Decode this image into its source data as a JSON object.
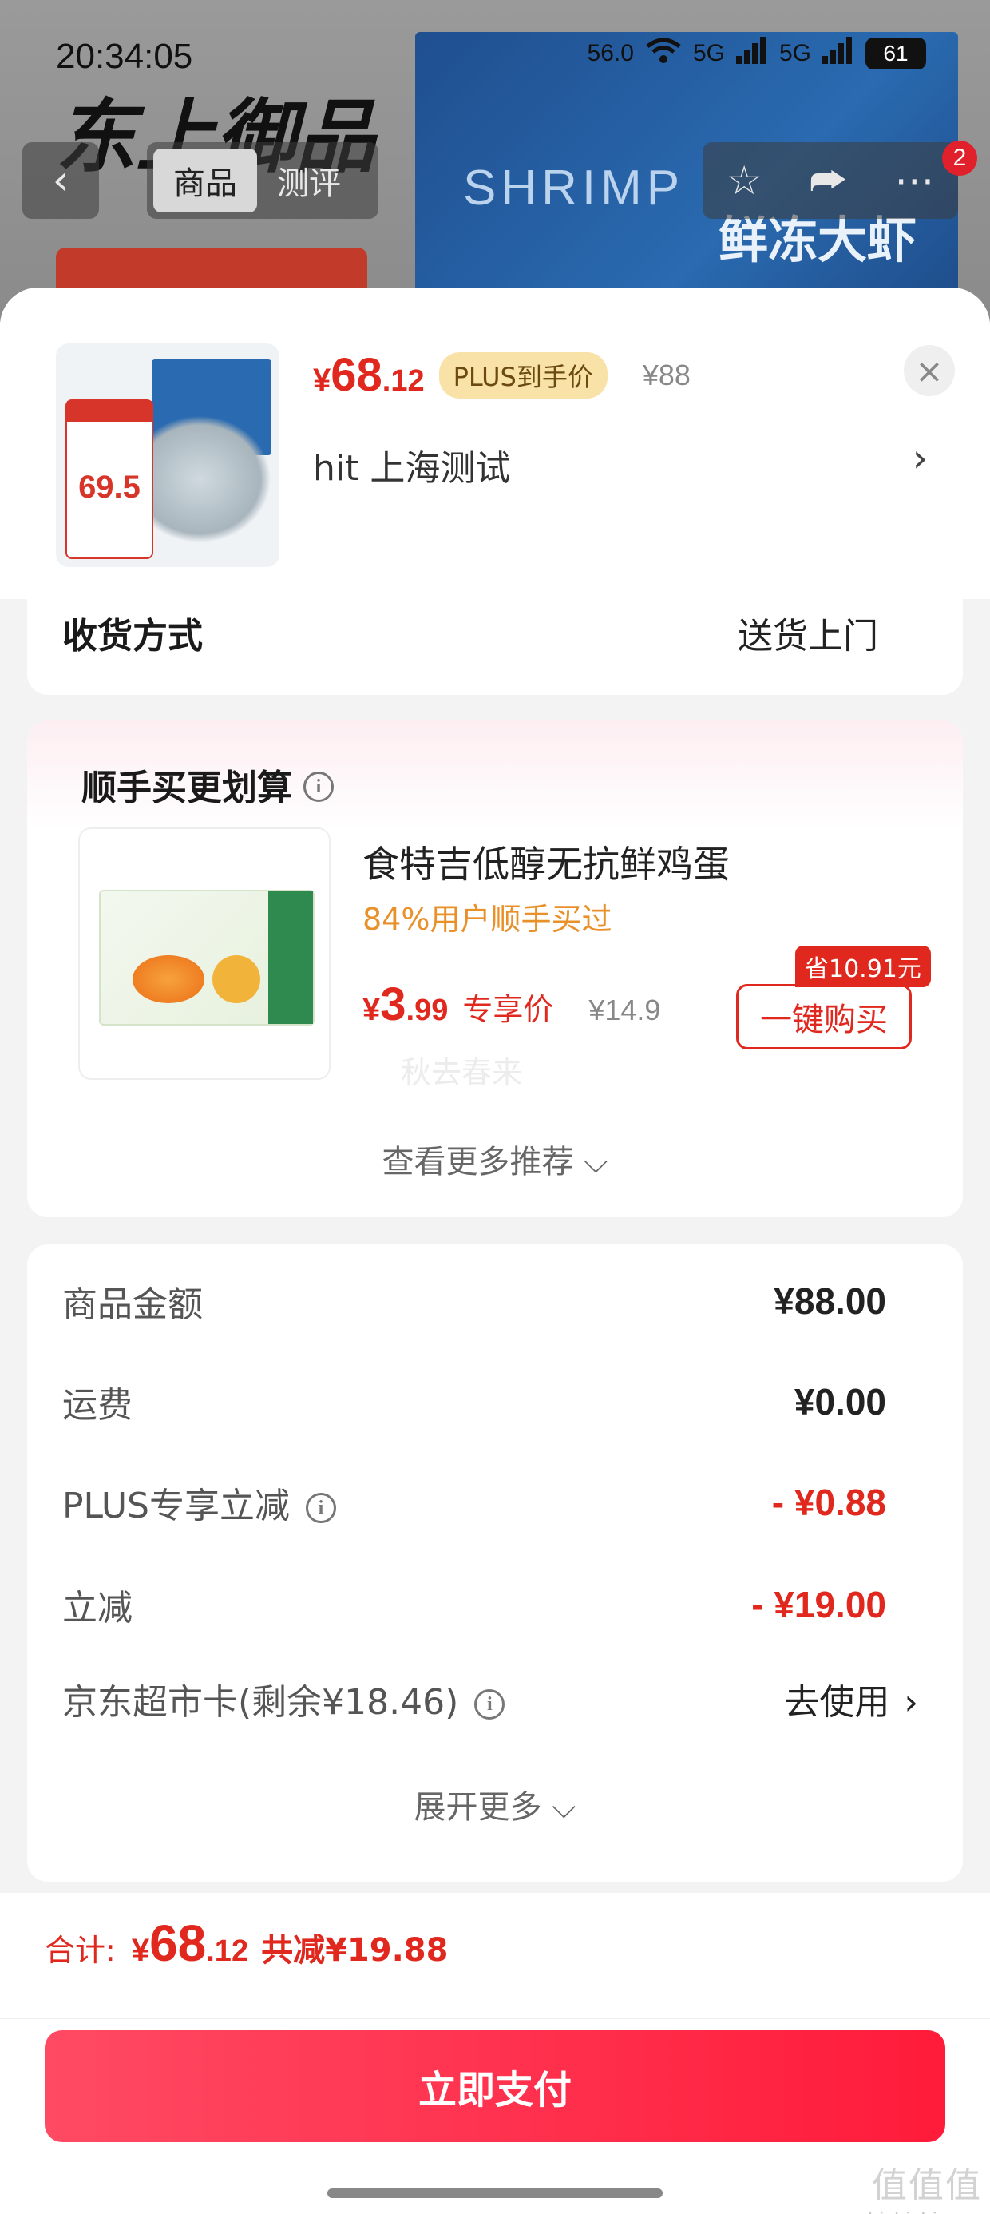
{
  "status_bar": {
    "time": "20:34:05",
    "net_speed": "56.0",
    "signal_a": "5G",
    "signal_b": "5G",
    "battery": "61"
  },
  "background_page": {
    "logo_text": "东上御品",
    "box_text_en": "SHRIMP",
    "box_text_cn": "鲜冻大虾",
    "tabs": [
      "商品",
      "测评"
    ],
    "active_tab": "商品",
    "notification_count": "2"
  },
  "product": {
    "price_yen": "¥",
    "price_int": "68",
    "price_dec": ".12",
    "plus_tag": "PLUS到手价",
    "orig_price": "¥88",
    "address": "hit  上海测试",
    "thumb_price": "69.5"
  },
  "delivery": {
    "label": "收货方式",
    "value": "送货上门"
  },
  "recommendation": {
    "title": "顺手买更划算",
    "item_name": "食特吉低醇无抗鲜鸡蛋",
    "bought_text": "84%用户顺手买过",
    "price_yen": "¥",
    "price_int": "3",
    "price_dec": ".99",
    "price_tag": "专享价",
    "orig_price": "¥14.9",
    "save_badge": "省10.91元",
    "buy_button": "一键购买",
    "watermark": "秋去春来",
    "more_link": "查看更多推荐 ⌵"
  },
  "price_detail": {
    "rows": [
      {
        "label": "商品金额",
        "value": "¥88.00"
      },
      {
        "label": "运费",
        "value": "¥0.00"
      },
      {
        "label": "PLUS专享立减",
        "value": "- ¥0.88"
      },
      {
        "label": "立减",
        "value": "- ¥19.00"
      },
      {
        "label": "京东超市卡(剩余¥18.46)",
        "value": "去使用"
      }
    ],
    "expand_link": "展开更多 ⌵"
  },
  "footer": {
    "total_label": "合计:",
    "total_yen": "¥",
    "total_int": "68",
    "total_dec": ".12",
    "total_save": "共减¥19.88",
    "pay_button": "立即支付",
    "corner_watermark_logo": "值值值",
    "corner_watermark_url": "zhizhizhi.com"
  },
  "colors": {
    "accent_red": "#e0281e",
    "pay_button_start": "#ff4a64",
    "pay_button_end": "#ff1b3a",
    "plus_tag_bg": "#f9e2a8",
    "bought_orange": "#e8912a"
  }
}
